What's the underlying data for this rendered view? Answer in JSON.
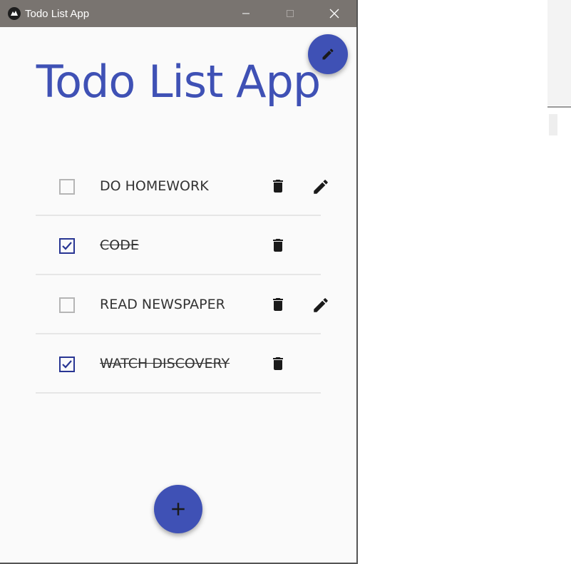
{
  "window": {
    "title": "Todo List App"
  },
  "header": {
    "title": "Todo List App"
  },
  "todos": [
    {
      "text": "DO HOMEWORK",
      "done": false,
      "editable": true
    },
    {
      "text": "CODE",
      "done": true,
      "editable": false
    },
    {
      "text": "READ NEWSPAPER",
      "done": false,
      "editable": true
    },
    {
      "text": "WATCH DISCOVERY",
      "done": true,
      "editable": false
    }
  ],
  "colors": {
    "accent": "#3f51b5",
    "checkbox_checked": "#283593",
    "checkbox_unchecked": "#b5b5b5",
    "titlebar": "#797470"
  },
  "icons": {
    "fab_top": "pencil-icon",
    "fab_bottom": "plus-icon",
    "row_delete": "trash-icon",
    "row_edit": "pencil-icon"
  }
}
